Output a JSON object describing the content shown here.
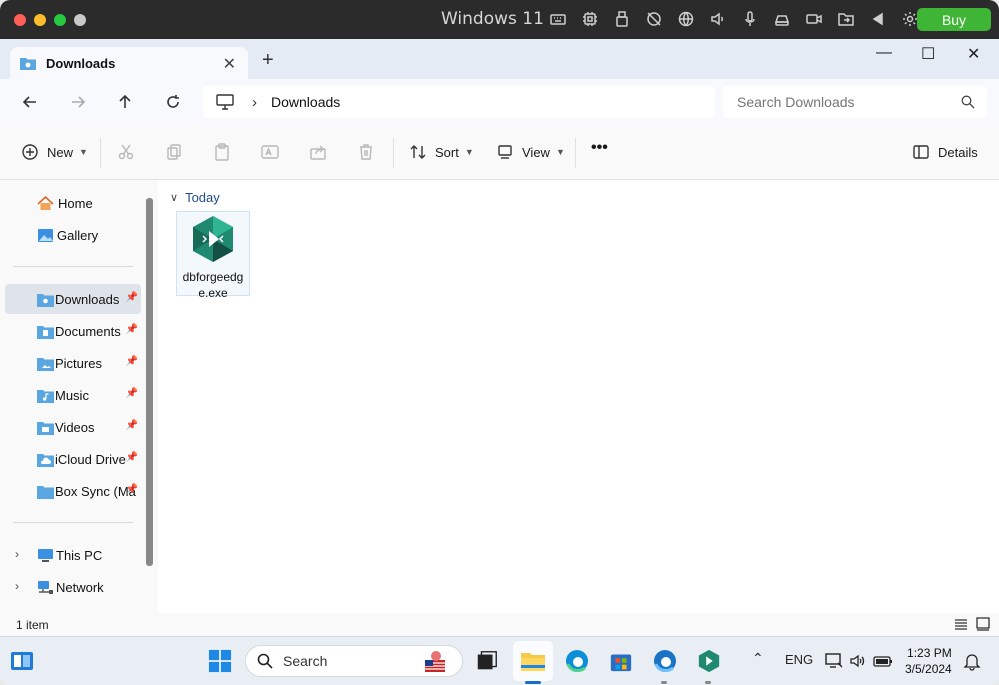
{
  "vm": {
    "title": "Windows 11",
    "buy_label": "Buy",
    "traffic_colors": [
      "#ff5f57",
      "#febc2e",
      "#28c840",
      "#c9c9c9"
    ],
    "icons": [
      "keyboard-icon",
      "cpu-icon",
      "usb-icon",
      "camera-off-icon",
      "network-globe-icon",
      "speaker-icon",
      "microphone-icon",
      "drive-icon",
      "camera-icon",
      "shared-folder-icon",
      "play-back-icon",
      "settings-gear-icon"
    ]
  },
  "window": {
    "tab_label": "Downloads",
    "new_tab_label": "+",
    "minimize": "—",
    "maximize": "☐",
    "close": "✕"
  },
  "address": {
    "separator": "›",
    "path": "Downloads",
    "search_placeholder": "Search Downloads"
  },
  "commands": {
    "new_label": "New",
    "sort_label": "Sort",
    "view_label": "View",
    "more_label": "•••",
    "details_label": "Details"
  },
  "sidebar": {
    "home": "Home",
    "gallery": "Gallery",
    "pinned": [
      {
        "label": "Downloads",
        "icon": "downloads-folder-icon"
      },
      {
        "label": "Documents",
        "icon": "documents-folder-icon"
      },
      {
        "label": "Pictures",
        "icon": "pictures-folder-icon"
      },
      {
        "label": "Music",
        "icon": "music-folder-icon"
      },
      {
        "label": "Videos",
        "icon": "videos-folder-icon"
      },
      {
        "label": "iCloud Drive",
        "icon": "icloud-folder-icon"
      },
      {
        "label": "Box Sync (Ma",
        "icon": "box-folder-icon"
      }
    ],
    "this_pc": "This PC",
    "network": "Network"
  },
  "content": {
    "group_label": "Today",
    "files": [
      {
        "name": "dbforgeedge.exe",
        "icon": "dbforge-app-icon"
      }
    ]
  },
  "status": {
    "item_count": "1 item"
  },
  "taskbar": {
    "search_label": "Search",
    "language": "ENG",
    "time": "1:23 PM",
    "date": "3/5/2024"
  },
  "colors": {
    "accent": "#1a6fc8",
    "buy": "#3eb534",
    "folder": "#5aa6e0"
  }
}
